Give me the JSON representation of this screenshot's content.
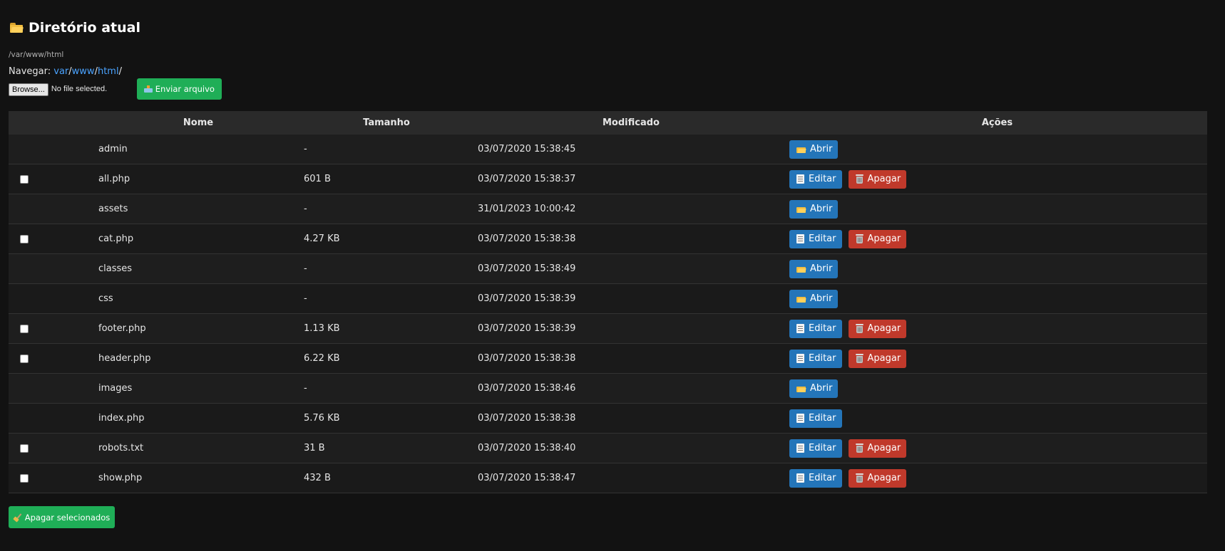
{
  "header": {
    "title": "Diretório atual",
    "path": "/var/www/html"
  },
  "nav": {
    "label": "Navegar:",
    "crumbs": [
      "var",
      "www",
      "html"
    ],
    "separator": "/"
  },
  "upload": {
    "browse_label": "Browse...",
    "no_file": "No file selected.",
    "send_label": "Enviar arquivo"
  },
  "table": {
    "headers": {
      "name": "Nome",
      "size": "Tamanho",
      "modified": "Modificado",
      "actions": "Ações"
    },
    "rows": [
      {
        "name": "admin",
        "size": "-",
        "modified": "03/07/2020 15:38:45",
        "checkbox": false,
        "actions": [
          "Abrir"
        ]
      },
      {
        "name": "all.php",
        "size": "601 B",
        "modified": "03/07/2020 15:38:37",
        "checkbox": true,
        "actions": [
          "Editar",
          "Apagar"
        ]
      },
      {
        "name": "assets",
        "size": "-",
        "modified": "31/01/2023 10:00:42",
        "checkbox": false,
        "actions": [
          "Abrir"
        ]
      },
      {
        "name": "cat.php",
        "size": "4.27 KB",
        "modified": "03/07/2020 15:38:38",
        "checkbox": true,
        "actions": [
          "Editar",
          "Apagar"
        ]
      },
      {
        "name": "classes",
        "size": "-",
        "modified": "03/07/2020 15:38:49",
        "checkbox": false,
        "actions": [
          "Abrir"
        ]
      },
      {
        "name": "css",
        "size": "-",
        "modified": "03/07/2020 15:38:39",
        "checkbox": false,
        "actions": [
          "Abrir"
        ]
      },
      {
        "name": "footer.php",
        "size": "1.13 KB",
        "modified": "03/07/2020 15:38:39",
        "checkbox": true,
        "actions": [
          "Editar",
          "Apagar"
        ]
      },
      {
        "name": "header.php",
        "size": "6.22 KB",
        "modified": "03/07/2020 15:38:38",
        "checkbox": true,
        "actions": [
          "Editar",
          "Apagar"
        ]
      },
      {
        "name": "images",
        "size": "-",
        "modified": "03/07/2020 15:38:46",
        "checkbox": false,
        "actions": [
          "Abrir"
        ]
      },
      {
        "name": "index.php",
        "size": "5.76 KB",
        "modified": "03/07/2020 15:38:38",
        "checkbox": false,
        "actions": [
          "Editar"
        ]
      },
      {
        "name": "robots.txt",
        "size": "31 B",
        "modified": "03/07/2020 15:38:40",
        "checkbox": true,
        "actions": [
          "Editar",
          "Apagar"
        ]
      },
      {
        "name": "show.php",
        "size": "432 B",
        "modified": "03/07/2020 15:38:47",
        "checkbox": true,
        "actions": [
          "Editar",
          "Apagar"
        ]
      }
    ]
  },
  "footer": {
    "delete_selected_label": "Apagar selecionados"
  },
  "colors": {
    "background": "#121212",
    "primary": "#2475b9",
    "danger": "#c0392b",
    "success": "#1fae57",
    "link": "#4aa3ff"
  }
}
